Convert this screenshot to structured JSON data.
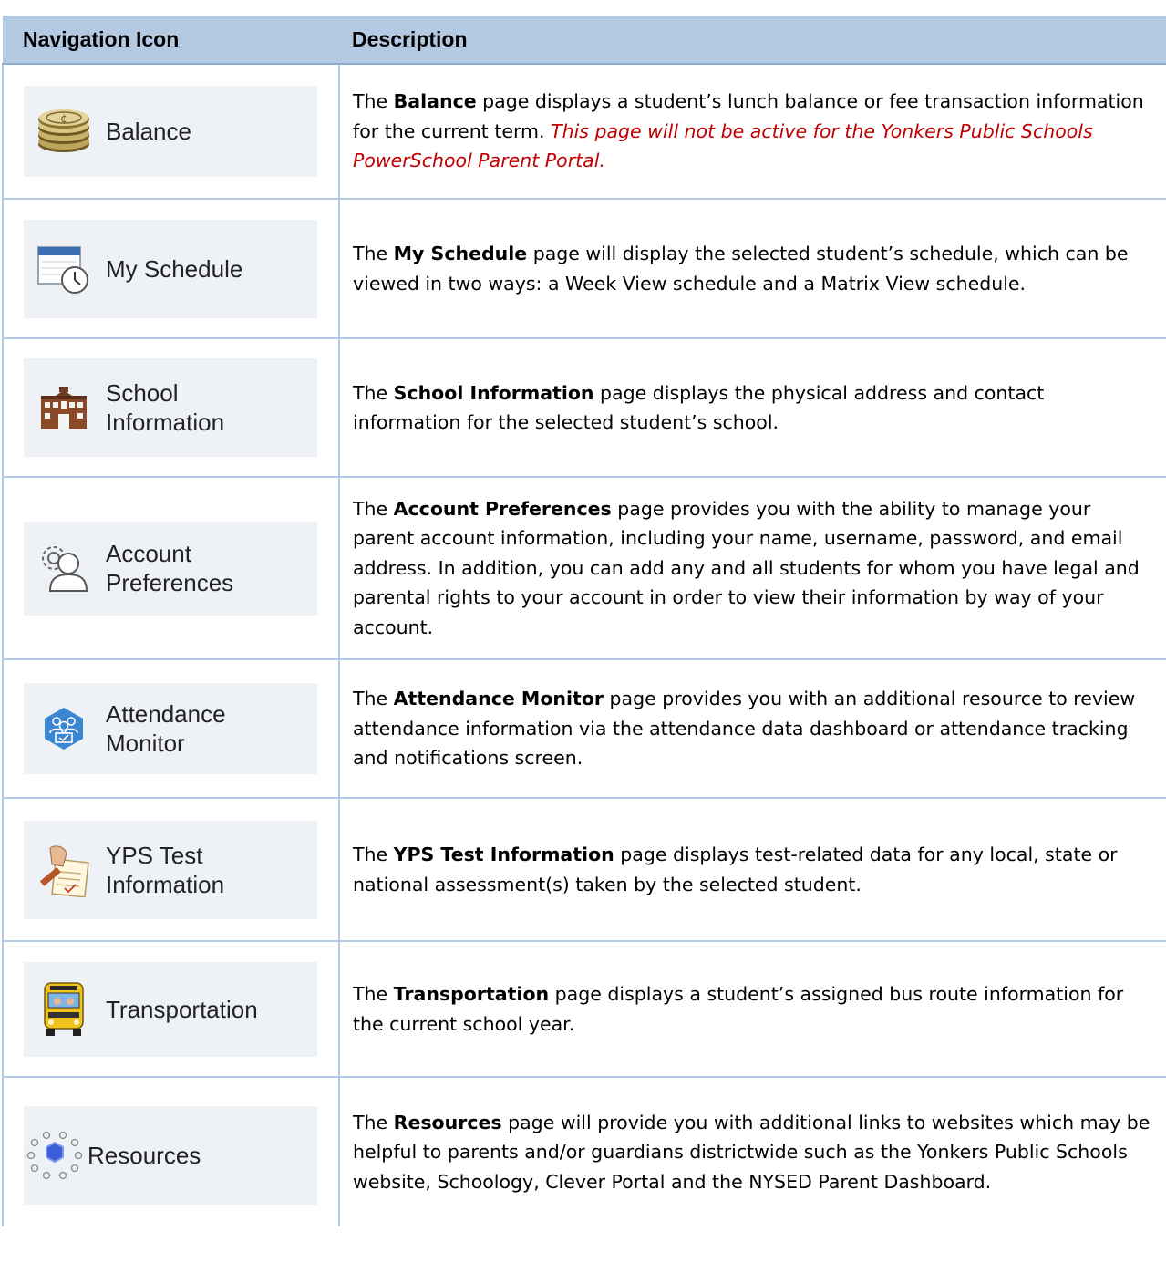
{
  "table": {
    "headers": {
      "icon": "Navigation Icon",
      "description": "Description"
    },
    "rows": [
      {
        "icon": "coin-stack-icon",
        "label": "Balance",
        "pre": "The ",
        "bold": "Balance",
        "post": " page displays a student’s lunch balance or fee transaction information for the current term. ",
        "note": "This page will not be active for the Yonkers Public Schools PowerSchool Parent Portal."
      },
      {
        "icon": "calendar-clock-icon",
        "label": "My Schedule",
        "pre": "The ",
        "bold": "My Schedule",
        "post": " page will display the selected student’s schedule, which can be viewed in two ways: a Week View schedule and a Matrix View schedule."
      },
      {
        "icon": "school-building-icon",
        "label": "School\nInformation",
        "pre": "The ",
        "bold": "School Information",
        "post": " page displays the physical address and contact information for the selected student’s school."
      },
      {
        "icon": "user-gear-icon",
        "label": "Account\nPreferences",
        "pre": "The ",
        "bold": "Account Preferences",
        "post": " page provides you with the ability to manage your parent account information, including your name, username, password, and email address. In addition, you can add any and all students for whom you have legal and parental rights to your account in order to view their information by way of your account."
      },
      {
        "icon": "attendance-hexagon-icon",
        "label": "Attendance\nMonitor",
        "pre": "The ",
        "bold": "Attendance Monitor",
        "post": " page provides you with an additional resource to review attendance information via the attendance data dashboard or attendance tracking and notifications screen."
      },
      {
        "icon": "test-paper-icon",
        "label": "YPS Test\nInformation",
        "pre": "The ",
        "bold": "YPS Test Information",
        "post": " page displays test-related data for any local, state or national assessment(s) taken by the selected student."
      },
      {
        "icon": "school-bus-icon",
        "label": "Transportation",
        "pre": "The ",
        "bold": "Transportation",
        "post": " page displays a student’s assigned bus route information for the current school year."
      },
      {
        "icon": "resources-network-icon",
        "label": "Resources",
        "pre": "The ",
        "bold": "Resources",
        "post": " page will provide you with additional links to websites which may be helpful to parents and/or guardians districtwide such as the Yonkers Public Schools website, Schoology, Clever Portal and the NYSED Parent Dashboard."
      }
    ]
  }
}
